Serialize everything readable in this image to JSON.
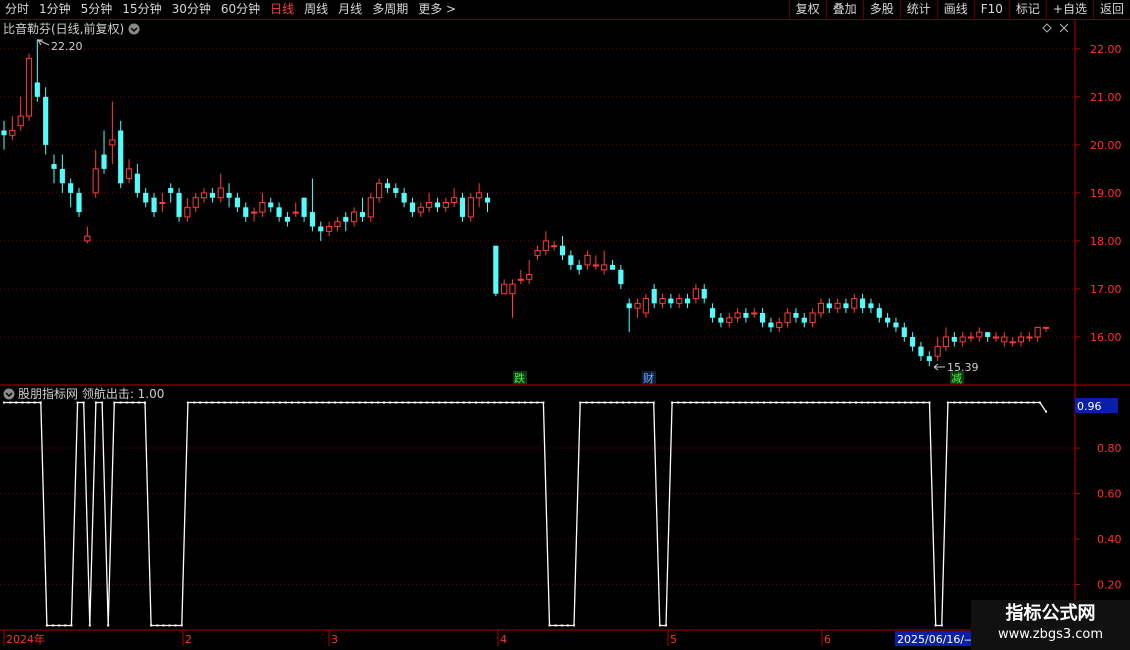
{
  "toolbar": {
    "left": [
      "分时",
      "1分钟",
      "5分钟",
      "15分钟",
      "30分钟",
      "60分钟",
      "日线",
      "周线",
      "月线",
      "多周期",
      "更多 >"
    ],
    "right": [
      "复权",
      "叠加",
      "多股",
      "统计",
      "画线",
      "F10",
      "标记",
      "+自选",
      "返回"
    ],
    "active": "日线"
  },
  "main_panel": {
    "title": "比音勒芬(日线,前复权)",
    "high_label": "22.20",
    "low_label": "15.39",
    "markers": [
      "跌",
      "财",
      "减"
    ]
  },
  "indicator_panel": {
    "title": "股朋指标网  领航出击: 1.00",
    "current_value_label": "0.96"
  },
  "time_axis": {
    "labels": [
      "2024年",
      "2",
      "3",
      "4",
      "5",
      "6"
    ],
    "cursor_date": "2025/06/16/—"
  },
  "watermark": {
    "title": "指标公式网",
    "url": "www.zbgs3.com"
  },
  "colors": {
    "up": "#ff3b3b",
    "down": "#54fcfc",
    "axis": "#b00000",
    "grid": "#6a0000",
    "line": "#ffffff"
  },
  "chart_data": [
    {
      "type": "candlestick",
      "title": "比音勒芬(日线,前复权)",
      "y_ticks": [
        16.0,
        17.0,
        18.0,
        19.0,
        20.0,
        21.0,
        22.0
      ],
      "ylim": [
        15.0,
        22.6
      ],
      "x_month_labels": [
        "2024年",
        "2",
        "3",
        "4",
        "5",
        "6"
      ],
      "candles": [
        [
          20.3,
          20.2,
          20.5,
          19.9
        ],
        [
          20.2,
          20.3,
          20.6,
          20.1
        ],
        [
          20.4,
          20.6,
          21.0,
          20.3
        ],
        [
          20.6,
          21.8,
          21.9,
          20.5
        ],
        [
          21.3,
          21.0,
          22.2,
          20.9
        ],
        [
          21.0,
          20.0,
          21.2,
          19.8
        ],
        [
          19.6,
          19.5,
          19.8,
          19.2
        ],
        [
          19.5,
          19.2,
          19.8,
          19.0
        ],
        [
          19.2,
          19.0,
          19.3,
          18.7
        ],
        [
          19.0,
          18.6,
          19.1,
          18.5
        ],
        [
          18.0,
          18.1,
          18.3,
          17.95
        ],
        [
          19.0,
          19.5,
          19.9,
          18.9
        ],
        [
          19.8,
          19.5,
          20.3,
          19.4
        ],
        [
          20.0,
          20.1,
          20.9,
          19.6
        ],
        [
          20.3,
          19.2,
          20.5,
          19.1
        ],
        [
          19.3,
          19.5,
          19.7,
          19.2
        ],
        [
          19.4,
          19.0,
          19.6,
          18.9
        ],
        [
          19.0,
          18.8,
          19.1,
          18.7
        ],
        [
          18.9,
          18.6,
          19.0,
          18.5
        ],
        [
          18.8,
          18.8,
          19.0,
          18.6
        ],
        [
          19.1,
          19.0,
          19.2,
          18.8
        ],
        [
          19.0,
          18.5,
          19.1,
          18.4
        ],
        [
          18.5,
          18.7,
          18.9,
          18.4
        ],
        [
          18.7,
          18.9,
          19.0,
          18.6
        ],
        [
          18.9,
          19.0,
          19.1,
          18.8
        ],
        [
          19.0,
          18.9,
          19.1,
          18.8
        ],
        [
          18.9,
          19.1,
          19.4,
          18.8
        ],
        [
          19.0,
          18.9,
          19.2,
          18.7
        ],
        [
          18.9,
          18.7,
          19.0,
          18.6
        ],
        [
          18.7,
          18.5,
          18.8,
          18.4
        ],
        [
          18.6,
          18.6,
          18.7,
          18.4
        ],
        [
          18.6,
          18.8,
          19.0,
          18.5
        ],
        [
          18.8,
          18.7,
          18.9,
          18.6
        ],
        [
          18.7,
          18.5,
          18.8,
          18.4
        ],
        [
          18.5,
          18.4,
          18.6,
          18.3
        ],
        [
          18.6,
          18.6,
          18.8,
          18.5
        ],
        [
          18.9,
          18.5,
          18.9,
          18.4
        ],
        [
          18.6,
          18.3,
          19.3,
          18.2
        ],
        [
          18.3,
          18.2,
          18.4,
          18.0
        ],
        [
          18.2,
          18.3,
          18.4,
          18.1
        ],
        [
          18.3,
          18.4,
          18.5,
          18.2
        ],
        [
          18.5,
          18.4,
          18.6,
          18.2
        ],
        [
          18.4,
          18.6,
          18.7,
          18.3
        ],
        [
          18.6,
          18.5,
          18.9,
          18.4
        ],
        [
          18.5,
          18.9,
          19.0,
          18.4
        ],
        [
          18.9,
          19.2,
          19.3,
          18.8
        ],
        [
          19.2,
          19.1,
          19.3,
          19.0
        ],
        [
          19.1,
          19.0,
          19.2,
          18.9
        ],
        [
          19.0,
          18.8,
          19.1,
          18.7
        ],
        [
          18.8,
          18.6,
          18.9,
          18.5
        ],
        [
          18.6,
          18.7,
          18.8,
          18.5
        ],
        [
          18.7,
          18.8,
          19.0,
          18.6
        ],
        [
          18.8,
          18.7,
          18.9,
          18.6
        ],
        [
          18.7,
          18.8,
          18.9,
          18.6
        ],
        [
          18.8,
          18.9,
          19.1,
          18.7
        ],
        [
          18.9,
          18.5,
          19.0,
          18.4
        ],
        [
          18.5,
          18.9,
          19.0,
          18.4
        ],
        [
          18.9,
          19.0,
          19.2,
          18.7
        ],
        [
          18.9,
          18.8,
          19.0,
          18.6
        ],
        [
          17.9,
          16.9,
          17.9,
          16.85
        ],
        [
          16.9,
          17.1,
          17.2,
          16.9
        ],
        [
          16.9,
          17.1,
          17.2,
          16.4
        ],
        [
          17.2,
          17.2,
          17.4,
          17.1
        ],
        [
          17.2,
          17.3,
          17.6,
          17.1
        ],
        [
          17.7,
          17.8,
          17.9,
          17.6
        ],
        [
          17.8,
          18.0,
          18.2,
          17.7
        ],
        [
          17.9,
          17.9,
          18.0,
          17.8
        ],
        [
          17.9,
          17.7,
          18.1,
          17.6
        ],
        [
          17.7,
          17.5,
          17.8,
          17.4
        ],
        [
          17.5,
          17.4,
          17.6,
          17.3
        ],
        [
          17.5,
          17.7,
          17.8,
          17.4
        ],
        [
          17.5,
          17.5,
          17.7,
          17.4
        ],
        [
          17.4,
          17.5,
          17.8,
          17.3
        ],
        [
          17.5,
          17.4,
          17.6,
          17.4
        ],
        [
          17.4,
          17.1,
          17.5,
          17.0
        ],
        [
          16.7,
          16.6,
          16.8,
          16.1
        ],
        [
          16.6,
          16.7,
          16.8,
          16.4
        ],
        [
          16.5,
          16.8,
          16.9,
          16.4
        ],
        [
          17.0,
          16.7,
          17.1,
          16.6
        ],
        [
          16.7,
          16.8,
          16.9,
          16.6
        ],
        [
          16.8,
          16.7,
          16.9,
          16.6
        ],
        [
          16.7,
          16.8,
          16.9,
          16.6
        ],
        [
          16.8,
          16.7,
          16.9,
          16.6
        ],
        [
          16.8,
          17.0,
          17.1,
          16.7
        ],
        [
          17.0,
          16.8,
          17.1,
          16.7
        ],
        [
          16.6,
          16.4,
          16.7,
          16.3
        ],
        [
          16.4,
          16.3,
          16.5,
          16.2
        ],
        [
          16.3,
          16.4,
          16.5,
          16.2
        ],
        [
          16.4,
          16.5,
          16.6,
          16.3
        ],
        [
          16.5,
          16.4,
          16.6,
          16.3
        ],
        [
          16.5,
          16.5,
          16.6,
          16.4
        ],
        [
          16.5,
          16.3,
          16.6,
          16.2
        ],
        [
          16.3,
          16.2,
          16.4,
          16.1
        ],
        [
          16.2,
          16.3,
          16.4,
          16.1
        ],
        [
          16.3,
          16.5,
          16.6,
          16.2
        ],
        [
          16.5,
          16.4,
          16.6,
          16.3
        ],
        [
          16.4,
          16.3,
          16.5,
          16.2
        ],
        [
          16.3,
          16.5,
          16.6,
          16.2
        ],
        [
          16.5,
          16.7,
          16.8,
          16.4
        ],
        [
          16.7,
          16.6,
          16.8,
          16.5
        ],
        [
          16.6,
          16.7,
          16.8,
          16.5
        ],
        [
          16.7,
          16.6,
          16.8,
          16.5
        ],
        [
          16.6,
          16.8,
          16.9,
          16.5
        ],
        [
          16.8,
          16.6,
          16.9,
          16.5
        ],
        [
          16.7,
          16.6,
          16.8,
          16.5
        ],
        [
          16.6,
          16.4,
          16.7,
          16.3
        ],
        [
          16.4,
          16.3,
          16.5,
          16.2
        ],
        [
          16.3,
          16.2,
          16.4,
          16.1
        ],
        [
          16.2,
          16.0,
          16.3,
          15.9
        ],
        [
          16.0,
          15.8,
          16.1,
          15.7
        ],
        [
          15.8,
          15.6,
          15.9,
          15.5
        ],
        [
          15.6,
          15.5,
          15.7,
          15.39
        ],
        [
          15.6,
          15.8,
          16.0,
          15.5
        ],
        [
          15.8,
          16.0,
          16.2,
          15.7
        ],
        [
          16.0,
          15.9,
          16.1,
          15.8
        ],
        [
          15.9,
          16.0,
          16.1,
          15.8
        ],
        [
          16.0,
          16.0,
          16.1,
          15.9
        ],
        [
          16.0,
          16.1,
          16.2,
          15.9
        ],
        [
          16.1,
          16.0,
          16.1,
          15.9
        ],
        [
          16.0,
          16.0,
          16.1,
          15.9
        ],
        [
          15.9,
          16.0,
          16.1,
          15.8
        ],
        [
          15.9,
          15.9,
          16.0,
          15.8
        ],
        [
          15.9,
          16.0,
          16.1,
          15.8
        ],
        [
          16.0,
          16.0,
          16.1,
          15.9
        ],
        [
          16.0,
          16.2,
          16.2,
          15.9
        ],
        [
          16.2,
          16.2,
          16.2,
          16.1
        ]
      ]
    },
    {
      "type": "line",
      "title": "股朋指标网  领航出击: 1.00",
      "y_ticks": [
        0.2,
        0.4,
        0.6,
        0.8
      ],
      "ylim": [
        0.0,
        1.02
      ],
      "series": [
        {
          "values": [
            1,
            1,
            1,
            1,
            1,
            1,
            1,
            0.02,
            0.02,
            0.02,
            0.02,
            0.02,
            1,
            1,
            0.02,
            1,
            1,
            0.02,
            1,
            1,
            1,
            1,
            1,
            1,
            0.02,
            0.02,
            0.02,
            0.02,
            0.02,
            0.02,
            1,
            1,
            1,
            1,
            1,
            1,
            1,
            1,
            1,
            1,
            1,
            1,
            1,
            1,
            1,
            1,
            1,
            1,
            1,
            1,
            1,
            1,
            1,
            1,
            1,
            1,
            1,
            1,
            1,
            1,
            1,
            1,
            1,
            1,
            1,
            1,
            1,
            1,
            1,
            1,
            1,
            1,
            1,
            1,
            1,
            1,
            1,
            1,
            1,
            1,
            1,
            1,
            1,
            1,
            1,
            1,
            1,
            1,
            1,
            0.02,
            0.02,
            0.02,
            0.02,
            0.02,
            1,
            1,
            1,
            1,
            1,
            1,
            1,
            1,
            1,
            1,
            1,
            1,
            1,
            0.02,
            0.02,
            1,
            1,
            1,
            1,
            1,
            1,
            1,
            1,
            1,
            1,
            1,
            1,
            1,
            1,
            1,
            1,
            1,
            1,
            1,
            1,
            1,
            1,
            1,
            1,
            1,
            1,
            1,
            1,
            1,
            1,
            1,
            1,
            1,
            1,
            1,
            1,
            1,
            1,
            1,
            1,
            1,
            1,
            1,
            0.02,
            0.02,
            1,
            1,
            1,
            1,
            1,
            1,
            1,
            1,
            1,
            1,
            1,
            1,
            1,
            1,
            1,
            1,
            0.96
          ]
        }
      ]
    }
  ]
}
